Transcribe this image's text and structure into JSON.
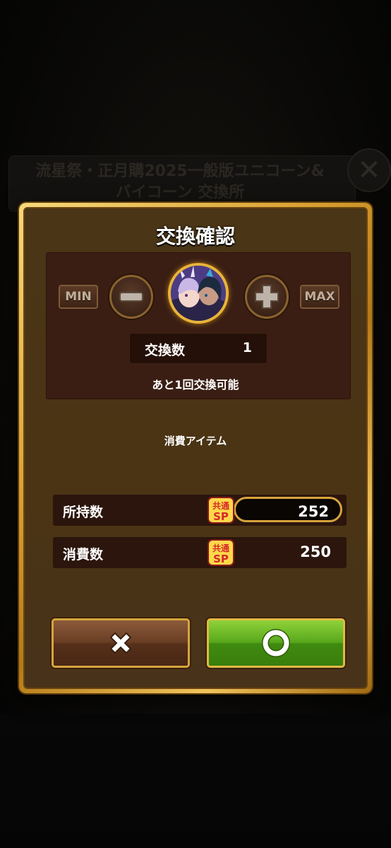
{
  "background": {
    "header_title": "流星祭・正月購2025一般版ユニコーン&バイコーン 交換所"
  },
  "dialog": {
    "title": "交換確認",
    "min_label": "MIN",
    "max_label": "MAX",
    "minus_icon": "minus-icon",
    "plus_icon": "plus-icon",
    "count_label": "交換数",
    "count_value": "1",
    "remaining_text": "あと1回交換可能",
    "consume_title": "消費アイテム",
    "rows": [
      {
        "label": "所持数",
        "value": "252",
        "icon": "sp-currency-icon",
        "icon_text": "共通SP"
      },
      {
        "label": "消費数",
        "value": "250",
        "icon": "sp-currency-icon",
        "icon_text": "共通SP"
      }
    ],
    "cancel_icon": "close-x-icon",
    "confirm_icon": "circle-o-icon"
  },
  "colors": {
    "gold_frame": "#d9a031",
    "panel_brown": "#4a3516",
    "confirm_green": "#58a81c",
    "cancel_brown": "#6a3e24"
  }
}
